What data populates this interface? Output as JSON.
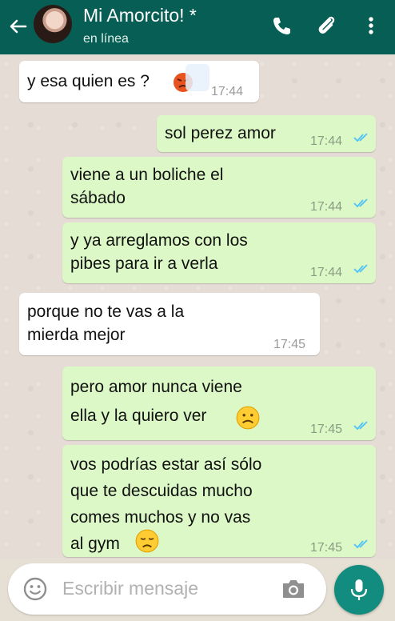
{
  "header": {
    "back_icon": "arrow-left-icon",
    "contact_name": "Mi Amorcito! *",
    "status": "en línea",
    "icons": [
      "phone-icon",
      "paperclip-icon",
      "more-vert-icon"
    ],
    "color": "#075e54"
  },
  "messages": [
    {
      "dir": "in",
      "text": "y esa quien es ?",
      "time": "17:44"
    },
    {
      "dir": "out",
      "text": "sol perez amor",
      "time": "17:44"
    },
    {
      "dir": "out",
      "text": "viene a un boliche el\nsábado",
      "time": "17:44"
    },
    {
      "dir": "out",
      "text": "y ya arreglamos con los\npibes para ir a verla",
      "time": "17:44"
    },
    {
      "dir": "in",
      "text": "porque no te vas a la\nmierda mejor",
      "time": "17:45"
    },
    {
      "dir": "out",
      "text": "pero amor nunca viene\nella y la quiero ver",
      "time": "17:45"
    },
    {
      "dir": "out",
      "text": "vos podrías estar así sólo\nque te descuidas mucho\ncomes muchos y no vas\nal gym",
      "time": "17:45"
    }
  ],
  "composer": {
    "placeholder": "Escribir mensaje",
    "emoji_icon": "smiley-icon",
    "camera_icon": "camera-icon",
    "mic_icon": "microphone-icon"
  },
  "colors": {
    "outgoing_bubble": "#dcf8c6",
    "incoming_bubble": "#ffffff",
    "read_tick": "#4fc3f7",
    "mic_button": "#128c7e"
  }
}
